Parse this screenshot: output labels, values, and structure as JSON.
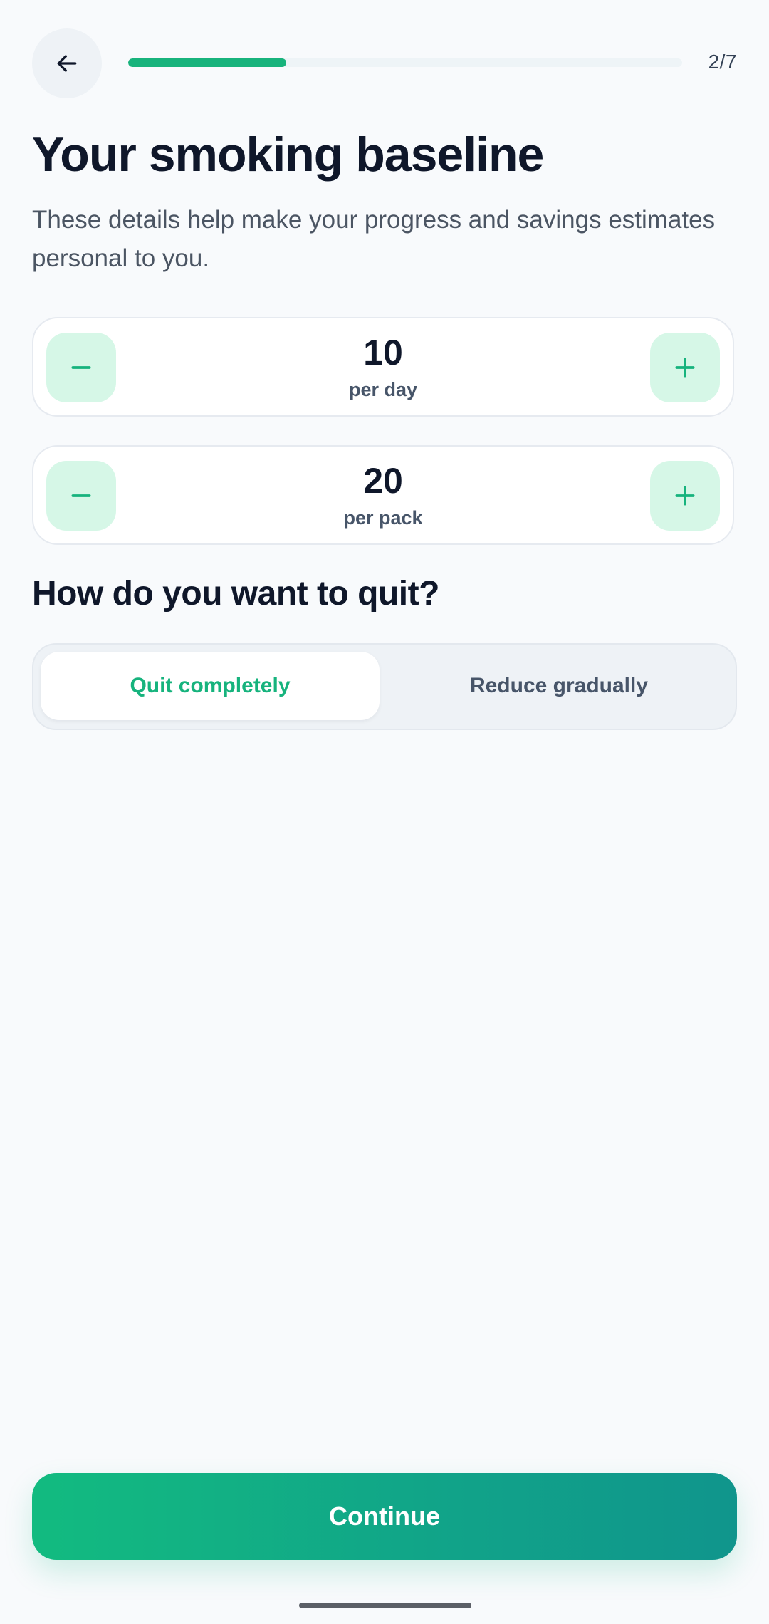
{
  "header": {
    "back_icon": "arrow-left-icon",
    "progress_fraction": 0.2857,
    "step_counter": "2/7"
  },
  "page": {
    "title": "Your smoking baseline",
    "subtitle": "These details help make your progress and savings estimates personal to you."
  },
  "steppers": [
    {
      "value": "10",
      "unit": "per day",
      "minus_icon": "minus-icon",
      "plus_icon": "plus-icon"
    },
    {
      "value": "20",
      "unit": "per pack",
      "minus_icon": "minus-icon",
      "plus_icon": "plus-icon"
    }
  ],
  "quit_method": {
    "title": "How do you want to quit?",
    "options": [
      "Quit completely",
      "Reduce gradually"
    ],
    "selected": "Quit completely"
  },
  "footer": {
    "continue_label": "Continue"
  },
  "colors": {
    "accent": "#18b37c",
    "accent_soft": "#d6f7e7",
    "background": "#f8fafc",
    "text_primary": "#0f172a",
    "text_secondary": "#4b5563"
  }
}
